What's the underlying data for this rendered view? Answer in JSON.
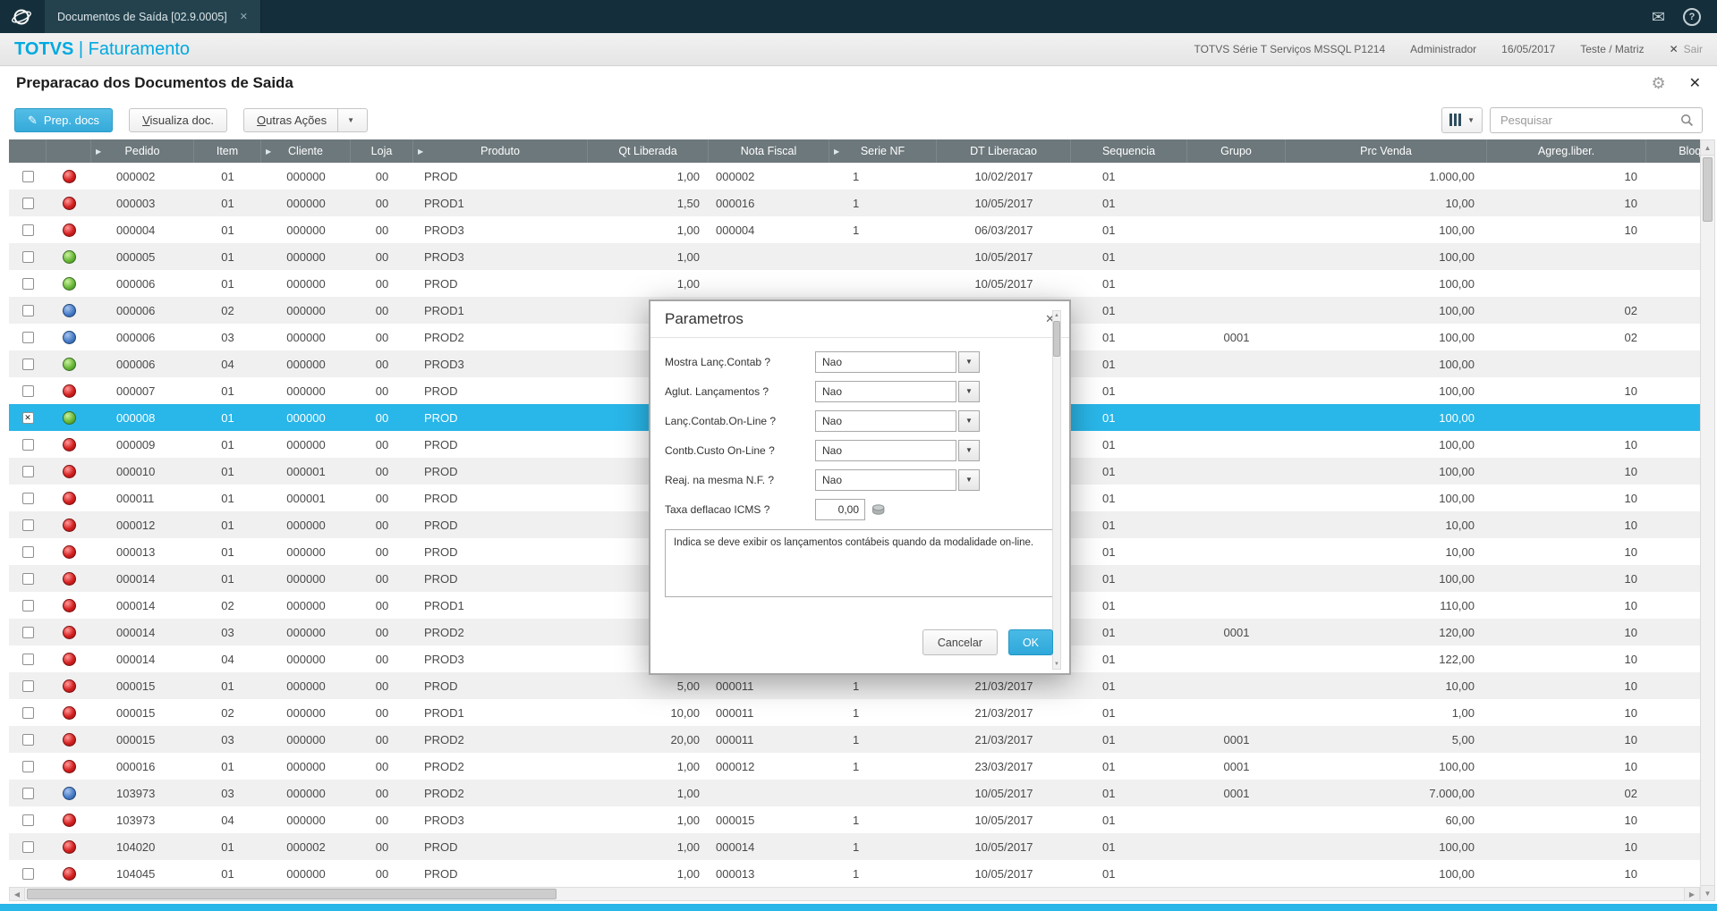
{
  "tabbar": {
    "tab_title": "Documentos de Saída [02.9.0005]"
  },
  "header": {
    "brand_bold": "TOTVS",
    "brand_rest": " | Faturamento",
    "environment": "TOTVS Série T Serviços MSSQL P1214",
    "user": "Administrador",
    "date": "16/05/2017",
    "company": "Teste / Matriz",
    "exit_label": "Sair"
  },
  "page": {
    "title": "Preparacao dos Documentos de Saida"
  },
  "toolbar": {
    "prep_docs_label": "Prep. docs",
    "visualiza_label": "Visualiza doc.",
    "outras_acoes_label": "Outras Ações",
    "search_placeholder": "Pesquisar"
  },
  "grid": {
    "columns": [
      {
        "key": "pedido",
        "label": "Pedido",
        "arrow": true
      },
      {
        "key": "item",
        "label": "Item"
      },
      {
        "key": "cliente",
        "label": "Cliente",
        "arrow": true
      },
      {
        "key": "loja",
        "label": "Loja"
      },
      {
        "key": "produto",
        "label": "Produto",
        "arrow": true
      },
      {
        "key": "qt",
        "label": "Qt Liberada"
      },
      {
        "key": "nf",
        "label": "Nota Fiscal"
      },
      {
        "key": "serie",
        "label": "Serie NF",
        "arrow": true
      },
      {
        "key": "dt",
        "label": "DT Liberacao"
      },
      {
        "key": "seq",
        "label": "Sequencia"
      },
      {
        "key": "grupo",
        "label": "Grupo"
      },
      {
        "key": "prc",
        "label": "Prc Venda"
      },
      {
        "key": "agreg",
        "label": "Agreg.liber."
      },
      {
        "key": "bloq",
        "label": "Bloq Est"
      }
    ],
    "rows": [
      {
        "status": "red",
        "pedido": "000002",
        "item": "01",
        "cliente": "000000",
        "loja": "00",
        "produto": "PROD",
        "qt": "1,00",
        "nf": "000002",
        "serie": "1",
        "dt": "10/02/2017",
        "seq": "01",
        "grupo": "",
        "prc": "1.000,00",
        "agreg": "10",
        "bloq": ""
      },
      {
        "status": "red",
        "pedido": "000003",
        "item": "01",
        "cliente": "000000",
        "loja": "00",
        "produto": "PROD1",
        "qt": "1,50",
        "nf": "000016",
        "serie": "1",
        "dt": "10/05/2017",
        "seq": "01",
        "grupo": "",
        "prc": "10,00",
        "agreg": "10",
        "bloq": ""
      },
      {
        "status": "red",
        "pedido": "000004",
        "item": "01",
        "cliente": "000000",
        "loja": "00",
        "produto": "PROD3",
        "qt": "1,00",
        "nf": "000004",
        "serie": "1",
        "dt": "06/03/2017",
        "seq": "01",
        "grupo": "",
        "prc": "100,00",
        "agreg": "10",
        "bloq": ""
      },
      {
        "status": "green",
        "pedido": "000005",
        "item": "01",
        "cliente": "000000",
        "loja": "00",
        "produto": "PROD3",
        "qt": "1,00",
        "nf": "",
        "serie": "",
        "dt": "10/05/2017",
        "seq": "01",
        "grupo": "",
        "prc": "100,00",
        "agreg": "",
        "bloq": ""
      },
      {
        "status": "green",
        "pedido": "000006",
        "item": "01",
        "cliente": "000000",
        "loja": "00",
        "produto": "PROD",
        "qt": "1,00",
        "nf": "",
        "serie": "",
        "dt": "10/05/2017",
        "seq": "01",
        "grupo": "",
        "prc": "100,00",
        "agreg": "",
        "bloq": ""
      },
      {
        "status": "blue",
        "pedido": "000006",
        "item": "02",
        "cliente": "000000",
        "loja": "00",
        "produto": "PROD1",
        "qt": "",
        "nf": "",
        "serie": "",
        "dt": "",
        "seq": "01",
        "grupo": "",
        "prc": "100,00",
        "agreg": "02",
        "bloq": ""
      },
      {
        "status": "blue",
        "pedido": "000006",
        "item": "03",
        "cliente": "000000",
        "loja": "00",
        "produto": "PROD2",
        "qt": "",
        "nf": "",
        "serie": "",
        "dt": "",
        "seq": "01",
        "grupo": "0001",
        "prc": "100,00",
        "agreg": "02",
        "bloq": ""
      },
      {
        "status": "green",
        "pedido": "000006",
        "item": "04",
        "cliente": "000000",
        "loja": "00",
        "produto": "PROD3",
        "qt": "",
        "nf": "",
        "serie": "",
        "dt": "",
        "seq": "01",
        "grupo": "",
        "prc": "100,00",
        "agreg": "",
        "bloq": ""
      },
      {
        "status": "red",
        "pedido": "000007",
        "item": "01",
        "cliente": "000000",
        "loja": "00",
        "produto": "PROD",
        "qt": "",
        "nf": "",
        "serie": "",
        "dt": "",
        "seq": "01",
        "grupo": "",
        "prc": "100,00",
        "agreg": "10",
        "bloq": ""
      },
      {
        "selected": true,
        "status": "green",
        "pedido": "000008",
        "item": "01",
        "cliente": "000000",
        "loja": "00",
        "produto": "PROD",
        "qt": "",
        "nf": "",
        "serie": "",
        "dt": "",
        "seq": "01",
        "grupo": "",
        "prc": "100,00",
        "agreg": "",
        "bloq": ""
      },
      {
        "status": "red",
        "pedido": "000009",
        "item": "01",
        "cliente": "000000",
        "loja": "00",
        "produto": "PROD",
        "qt": "",
        "nf": "",
        "serie": "",
        "dt": "",
        "seq": "01",
        "grupo": "",
        "prc": "100,00",
        "agreg": "10",
        "bloq": ""
      },
      {
        "status": "red",
        "pedido": "000010",
        "item": "01",
        "cliente": "000001",
        "loja": "00",
        "produto": "PROD",
        "qt": "",
        "nf": "",
        "serie": "",
        "dt": "",
        "seq": "01",
        "grupo": "",
        "prc": "100,00",
        "agreg": "10",
        "bloq": ""
      },
      {
        "status": "red",
        "pedido": "000011",
        "item": "01",
        "cliente": "000001",
        "loja": "00",
        "produto": "PROD",
        "qt": "",
        "nf": "",
        "serie": "",
        "dt": "",
        "seq": "01",
        "grupo": "",
        "prc": "100,00",
        "agreg": "10",
        "bloq": ""
      },
      {
        "status": "red",
        "pedido": "000012",
        "item": "01",
        "cliente": "000000",
        "loja": "00",
        "produto": "PROD",
        "qt": "",
        "nf": "",
        "serie": "",
        "dt": "",
        "seq": "01",
        "grupo": "",
        "prc": "10,00",
        "agreg": "10",
        "bloq": ""
      },
      {
        "status": "red",
        "pedido": "000013",
        "item": "01",
        "cliente": "000000",
        "loja": "00",
        "produto": "PROD",
        "qt": "",
        "nf": "",
        "serie": "",
        "dt": "",
        "seq": "01",
        "grupo": "",
        "prc": "10,00",
        "agreg": "10",
        "bloq": ""
      },
      {
        "status": "red",
        "pedido": "000014",
        "item": "01",
        "cliente": "000000",
        "loja": "00",
        "produto": "PROD",
        "qt": "",
        "nf": "",
        "serie": "",
        "dt": "",
        "seq": "01",
        "grupo": "",
        "prc": "100,00",
        "agreg": "10",
        "bloq": ""
      },
      {
        "status": "red",
        "pedido": "000014",
        "item": "02",
        "cliente": "000000",
        "loja": "00",
        "produto": "PROD1",
        "qt": "",
        "nf": "",
        "serie": "",
        "dt": "",
        "seq": "01",
        "grupo": "",
        "prc": "110,00",
        "agreg": "10",
        "bloq": ""
      },
      {
        "status": "red",
        "pedido": "000014",
        "item": "03",
        "cliente": "000000",
        "loja": "00",
        "produto": "PROD2",
        "qt": "",
        "nf": "",
        "serie": "",
        "dt": "",
        "seq": "01",
        "grupo": "0001",
        "prc": "120,00",
        "agreg": "10",
        "bloq": ""
      },
      {
        "status": "red",
        "pedido": "000014",
        "item": "04",
        "cliente": "000000",
        "loja": "00",
        "produto": "PROD3",
        "qt": "",
        "nf": "",
        "serie": "",
        "dt": "",
        "seq": "01",
        "grupo": "",
        "prc": "122,00",
        "agreg": "10",
        "bloq": ""
      },
      {
        "status": "red",
        "pedido": "000015",
        "item": "01",
        "cliente": "000000",
        "loja": "00",
        "produto": "PROD",
        "qt": "5,00",
        "nf": "000011",
        "serie": "1",
        "dt": "21/03/2017",
        "seq": "01",
        "grupo": "",
        "prc": "10,00",
        "agreg": "10",
        "bloq": ""
      },
      {
        "status": "red",
        "pedido": "000015",
        "item": "02",
        "cliente": "000000",
        "loja": "00",
        "produto": "PROD1",
        "qt": "10,00",
        "nf": "000011",
        "serie": "1",
        "dt": "21/03/2017",
        "seq": "01",
        "grupo": "",
        "prc": "1,00",
        "agreg": "10",
        "bloq": ""
      },
      {
        "status": "red",
        "pedido": "000015",
        "item": "03",
        "cliente": "000000",
        "loja": "00",
        "produto": "PROD2",
        "qt": "20,00",
        "nf": "000011",
        "serie": "1",
        "dt": "21/03/2017",
        "seq": "01",
        "grupo": "0001",
        "prc": "5,00",
        "agreg": "10",
        "bloq": ""
      },
      {
        "status": "red",
        "pedido": "000016",
        "item": "01",
        "cliente": "000000",
        "loja": "00",
        "produto": "PROD2",
        "qt": "1,00",
        "nf": "000012",
        "serie": "1",
        "dt": "23/03/2017",
        "seq": "01",
        "grupo": "0001",
        "prc": "100,00",
        "agreg": "10",
        "bloq": ""
      },
      {
        "status": "blue",
        "pedido": "103973",
        "item": "03",
        "cliente": "000000",
        "loja": "00",
        "produto": "PROD2",
        "qt": "1,00",
        "nf": "",
        "serie": "",
        "dt": "10/05/2017",
        "seq": "01",
        "grupo": "0001",
        "prc": "7.000,00",
        "agreg": "02",
        "bloq": ""
      },
      {
        "status": "red",
        "pedido": "103973",
        "item": "04",
        "cliente": "000000",
        "loja": "00",
        "produto": "PROD3",
        "qt": "1,00",
        "nf": "000015",
        "serie": "1",
        "dt": "10/05/2017",
        "seq": "01",
        "grupo": "",
        "prc": "60,00",
        "agreg": "10",
        "bloq": ""
      },
      {
        "status": "red",
        "pedido": "104020",
        "item": "01",
        "cliente": "000002",
        "loja": "00",
        "produto": "PROD",
        "qt": "1,00",
        "nf": "000014",
        "serie": "1",
        "dt": "10/05/2017",
        "seq": "01",
        "grupo": "",
        "prc": "100,00",
        "agreg": "10",
        "bloq": ""
      },
      {
        "status": "red",
        "pedido": "104045",
        "item": "01",
        "cliente": "000000",
        "loja": "00",
        "produto": "PROD",
        "qt": "1,00",
        "nf": "000013",
        "serie": "1",
        "dt": "10/05/2017",
        "seq": "01",
        "grupo": "",
        "prc": "100,00",
        "agreg": "10",
        "bloq": ""
      }
    ]
  },
  "modal": {
    "title": "Parametros",
    "fields": [
      {
        "label": "Mostra Lanç.Contab ?",
        "value": "Nao",
        "type": "select"
      },
      {
        "label": "Aglut. Lançamentos ?",
        "value": "Nao",
        "type": "select"
      },
      {
        "label": "Lanç.Contab.On-Line ?",
        "value": "Nao",
        "type": "select"
      },
      {
        "label": "Contb.Custo On-Line ?",
        "value": "Nao",
        "type": "select"
      },
      {
        "label": "Reaj. na mesma N.F. ?",
        "value": "Nao",
        "type": "select"
      },
      {
        "label": "Taxa deflacao ICMS ?",
        "value": "0,00",
        "type": "input"
      }
    ],
    "help_text": "Indica se deve exibir os lançamentos contábeis quando da modalidade on-line.",
    "cancel_label": "Cancelar",
    "ok_label": "OK"
  },
  "icons": {
    "mail": "✉",
    "help": "?",
    "close": "✕",
    "gear": "⚙",
    "pencil": "✎",
    "caret_down": "▼",
    "sort_arrow": "▶",
    "scroll_up": "▲",
    "scroll_down": "▼",
    "scroll_left": "◀",
    "scroll_right": "▶",
    "check_mark": "✕",
    "exit_x": "✕"
  },
  "colors": {
    "accent": "#29b6e8",
    "topbar_bg": "#142f3b",
    "grid_header_bg": "#6d787c",
    "selected_row": "#29b6e8",
    "status_red": "#d42020",
    "status_green": "#69b93a",
    "status_blue": "#4a7ec9"
  }
}
